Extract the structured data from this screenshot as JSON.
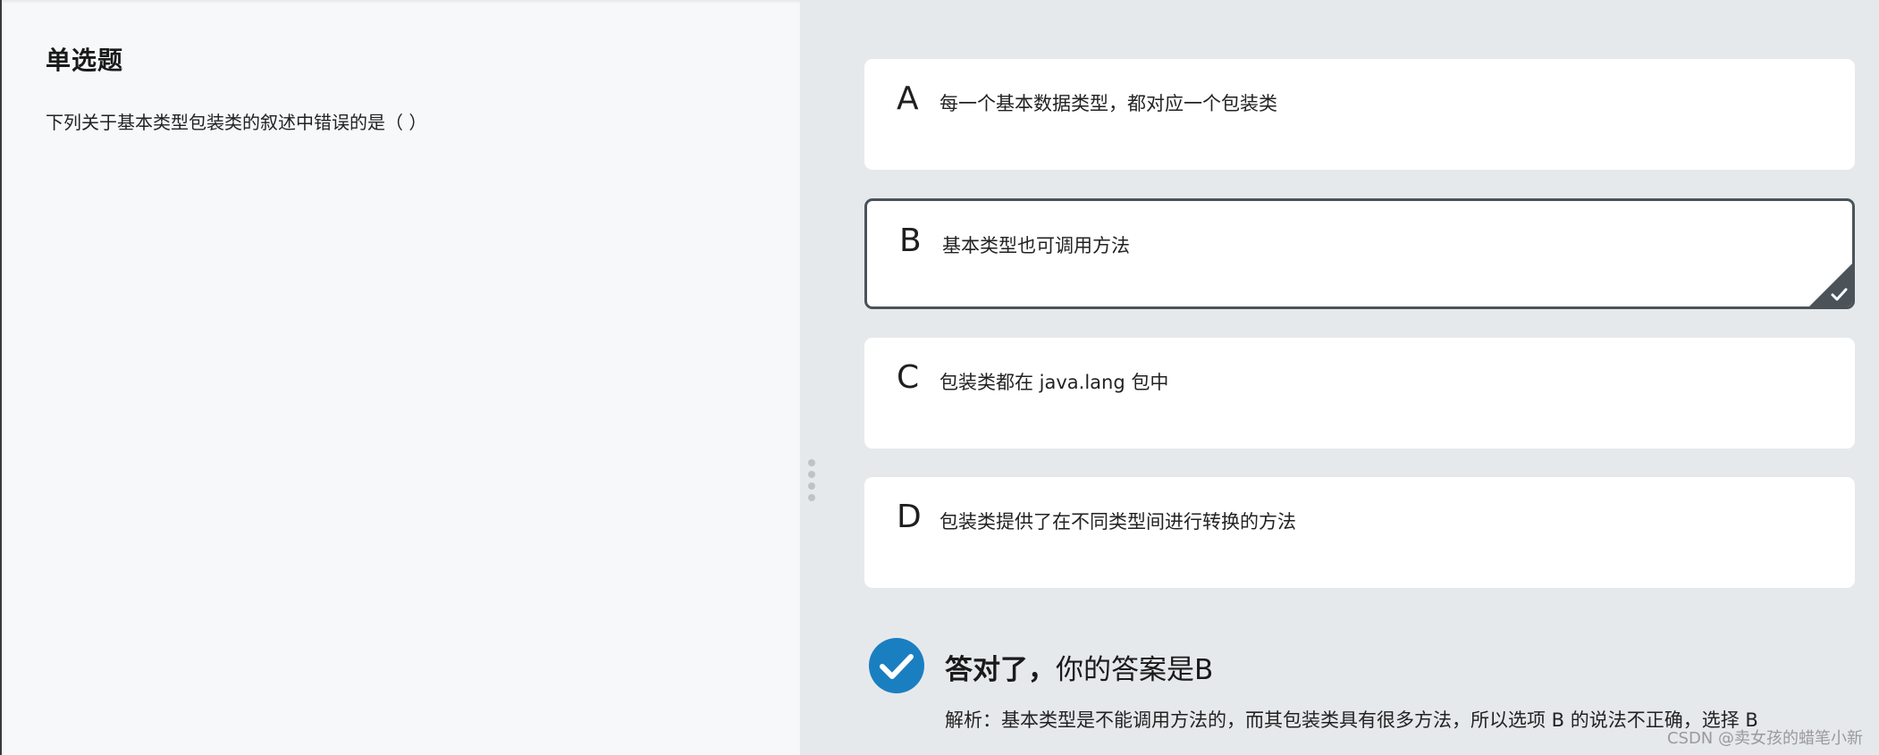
{
  "question": {
    "type_label": "单选题",
    "text": "下列关于基本类型包装类的叙述中错误的是（ ）"
  },
  "options": [
    {
      "letter": "A",
      "text": "每一个基本数据类型，都对应一个包装类",
      "selected": false
    },
    {
      "letter": "B",
      "text": "基本类型也可调用方法",
      "selected": true
    },
    {
      "letter": "C",
      "text": "包装类都在 java.lang 包中",
      "selected": false
    },
    {
      "letter": "D",
      "text": "包装类提供了在不同类型间进行转换的方法",
      "selected": false
    }
  ],
  "result": {
    "status_label": "答对了，",
    "answer_text": "你的答案是B",
    "analysis": "解析：基本类型是不能调用方法的，而其包装类具有很多方法，所以选项 B 的说法不正确，选择 B",
    "icon": "check-circle-icon",
    "icon_color": "#1a7fc1"
  },
  "watermark": "CSDN @卖女孩的蜡笔小新",
  "colors": {
    "left_bg": "#f7f8fa",
    "right_bg": "#e6e9ec",
    "selected_border": "#4b5359",
    "check_accent": "#1a7fc1"
  }
}
